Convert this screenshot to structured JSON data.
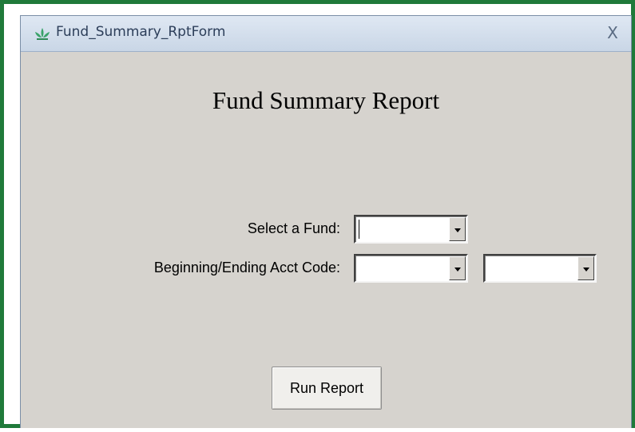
{
  "window": {
    "title": "Fund_Summary_RptForm",
    "close_label": "X"
  },
  "form": {
    "heading": "Fund Summary Report",
    "fund_label": "Select a Fund:",
    "fund_value": "",
    "acct_label": "Beginning/Ending Acct Code:",
    "begin_acct_value": "",
    "end_acct_value": "",
    "run_button_label": "Run Report"
  },
  "colors": {
    "frame_border": "#1f7a3a",
    "form_background": "#d6d3ce",
    "titlebar": "#dfe8f3",
    "app_icon": "#3aa36a"
  },
  "icons": {
    "app": "lotus-app-icon",
    "close": "close-icon",
    "dropdown": "chevron-down-icon"
  }
}
